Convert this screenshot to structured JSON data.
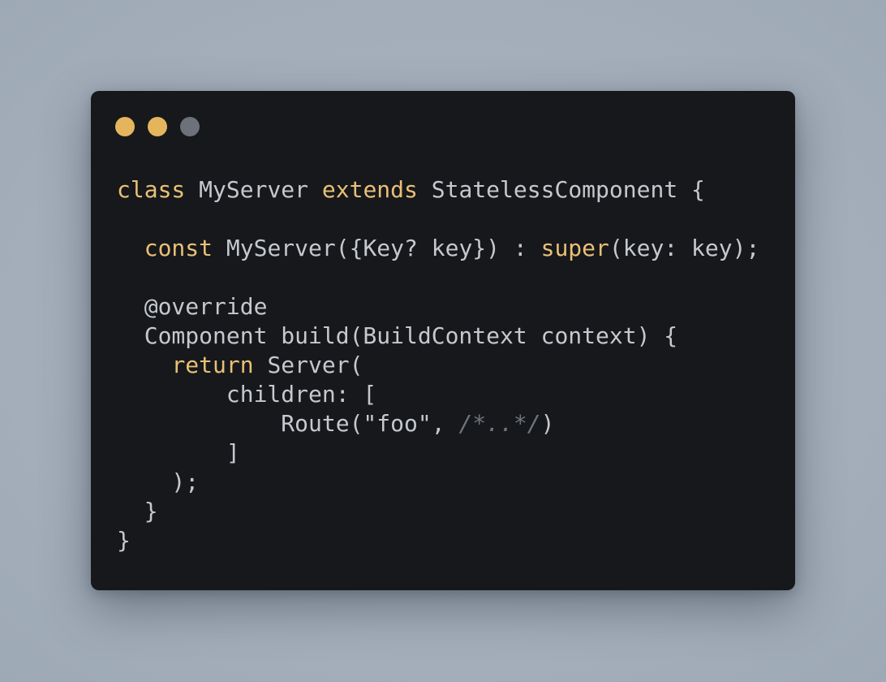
{
  "window": {
    "dots": [
      {
        "name": "close-dot",
        "color": "#e5b55e"
      },
      {
        "name": "minimize-dot",
        "color": "#e5b55e"
      },
      {
        "name": "maximize-dot",
        "color": "#6d7179"
      }
    ]
  },
  "colors": {
    "background": "#a9b3be",
    "window": "#16181b",
    "keyword": "#e9c077",
    "text": "#c5c8cd",
    "comment": "#6f747c"
  },
  "code": {
    "language": "dart",
    "lines": [
      [
        {
          "t": "kw",
          "v": "class"
        },
        {
          "t": "plain",
          "v": " MyServer "
        },
        {
          "t": "kw",
          "v": "extends"
        },
        {
          "t": "plain",
          "v": " StatelessComponent {"
        }
      ],
      [],
      [
        {
          "t": "plain",
          "v": "  "
        },
        {
          "t": "kw",
          "v": "const"
        },
        {
          "t": "plain",
          "v": " MyServer({Key? key}) : "
        },
        {
          "t": "kw",
          "v": "super"
        },
        {
          "t": "plain",
          "v": "(key: key);"
        }
      ],
      [],
      [
        {
          "t": "plain",
          "v": "  @override"
        }
      ],
      [
        {
          "t": "plain",
          "v": "  Component build(BuildContext context) {"
        }
      ],
      [
        {
          "t": "plain",
          "v": "    "
        },
        {
          "t": "kw",
          "v": "return"
        },
        {
          "t": "plain",
          "v": " Server("
        }
      ],
      [
        {
          "t": "plain",
          "v": "        children: ["
        }
      ],
      [
        {
          "t": "plain",
          "v": "            Route(\"foo\", "
        },
        {
          "t": "comment",
          "v": "/*..*/"
        },
        {
          "t": "plain",
          "v": ")"
        }
      ],
      [
        {
          "t": "plain",
          "v": "        ]"
        }
      ],
      [
        {
          "t": "plain",
          "v": "    );"
        }
      ],
      [
        {
          "t": "plain",
          "v": "  }"
        }
      ],
      [
        {
          "t": "plain",
          "v": "}"
        }
      ]
    ]
  }
}
